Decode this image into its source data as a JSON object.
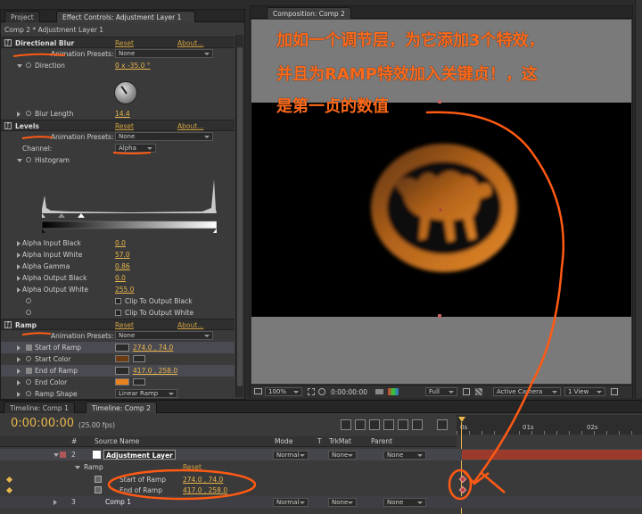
{
  "left_panel": {
    "tabs": [
      "Project",
      "Effect Controls: Adjustment Layer 1"
    ],
    "subtitle": "Comp 2 * Adjustment Layer 1",
    "effects": [
      {
        "name": "Directional Blur",
        "reset": "Reset",
        "about": "About...",
        "presets_label": "Animation Presets:",
        "presets_value": "None",
        "props": [
          {
            "label": "Direction",
            "value": "0 x -35.0 °"
          },
          {
            "label": "Blur Length",
            "value": "14.4"
          }
        ]
      },
      {
        "name": "Levels",
        "reset": "Reset",
        "about": "About...",
        "presets_label": "Animation Presets:",
        "presets_value": "None",
        "channel_label": "Channel:",
        "channel_value": "Alpha",
        "histogram_label": "Histogram",
        "props": [
          {
            "label": "Alpha Input Black",
            "value": "0.0"
          },
          {
            "label": "Alpha Input White",
            "value": "57.0"
          },
          {
            "label": "Alpha Gamma",
            "value": "0.86"
          },
          {
            "label": "Alpha Output Black",
            "value": "0.0"
          },
          {
            "label": "Alpha Output White",
            "value": "255.0"
          }
        ],
        "clip_black": "Clip To Output Black",
        "clip_white": "Clip To Output White"
      },
      {
        "name": "Ramp",
        "reset": "Reset",
        "about": "About...",
        "presets_label": "Animation Presets:",
        "presets_value": "None",
        "props": [
          {
            "label": "Start of Ramp",
            "value": "274.0 , 74.0"
          },
          {
            "label": "Start Color",
            "value": ""
          },
          {
            "label": "End of Ramp",
            "value": "417.0 , 258.0"
          },
          {
            "label": "End Color",
            "value": ""
          },
          {
            "label": "Ramp Shape",
            "value": "Linear Ramp"
          },
          {
            "label": "Ramp Scatter",
            "value": "0.0"
          }
        ]
      }
    ],
    "colors": {
      "start_color": "#6b3a10",
      "end_color": "#e8821e"
    }
  },
  "comp_panel": {
    "tab": "Composition: Comp 2",
    "annotation_lines": [
      "加如一个调节层，为它添加3个特效，",
      "并且为RAMP特效加入关键贞！，这",
      "是第一贞的数值"
    ],
    "footer": {
      "zoom": "100%",
      "timecode": "0:00:00:00",
      "resolution": "Full",
      "camera": "Active Camera",
      "views": "1 View"
    }
  },
  "timeline": {
    "tabs": [
      "Timeline: Comp 1",
      "Timeline: Comp 2"
    ],
    "timecode": "0:00:00:00",
    "fps": "(25.00 fps)",
    "columns": {
      "num": "#",
      "source": "Source Name",
      "mode": "Mode",
      "t": "T",
      "trkmat": "TrkMat",
      "parent": "Parent"
    },
    "ruler": [
      "0s",
      "01s",
      "02s"
    ],
    "layers": [
      {
        "num": "2",
        "name": "Adjustment Layer",
        "mode": "Normal",
        "trkmat": "None",
        "parent": "None"
      },
      {
        "num": "3",
        "name": "Comp 1",
        "mode": "Normal",
        "trkmat": "None",
        "parent": "None"
      }
    ],
    "ramp_label": "Ramp",
    "ramp_reset": "Reset",
    "keys": [
      {
        "label": "Start of Ramp",
        "value": "274.0 , 74.0"
      },
      {
        "label": "End of Ramp",
        "value": "417.0 , 258.0"
      }
    ]
  }
}
